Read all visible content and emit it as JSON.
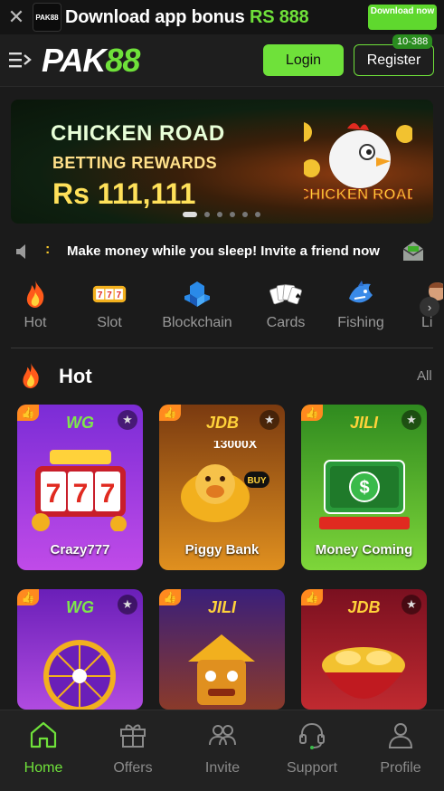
{
  "download_bar": {
    "logo_text": "PAK88",
    "text_prefix": "Download app bonus ",
    "text_amount": "RS 888",
    "button_label": "Download now"
  },
  "header": {
    "logo_pak": "PAK",
    "logo_num": "88",
    "login_label": "Login",
    "register_label": "Register",
    "register_badge": "10-388"
  },
  "banner": {
    "title": "CHICKEN ROAD",
    "subtitle": "BETTING REWARDS",
    "amount": "Rs 111,111",
    "game_logo": "CHICKEN ROAD",
    "slide_count": 6,
    "active_slide": 0
  },
  "marquee": {
    "colon": ":",
    "text": "Make money while you sleep! Invite a friend now"
  },
  "categories": [
    {
      "label": "Hot",
      "icon": "flame-icon"
    },
    {
      "label": "Slot",
      "icon": "slot-777-icon"
    },
    {
      "label": "Blockchain",
      "icon": "blockchain-icon"
    },
    {
      "label": "Cards",
      "icon": "cards-icon"
    },
    {
      "label": "Fishing",
      "icon": "shark-icon"
    },
    {
      "label": "Li",
      "icon": "live-icon"
    }
  ],
  "hot_section": {
    "title": "Hot",
    "all_label": "All"
  },
  "games": [
    {
      "name": "Crazy777",
      "brand": "WG",
      "colors": [
        "#7b2cd6",
        "#c04be8"
      ]
    },
    {
      "name": "Piggy Bank",
      "brand": "JDB",
      "colors": [
        "#7a3a10",
        "#e0901f"
      ],
      "tag": "13000X"
    },
    {
      "name": "Money Coming",
      "brand": "JILI",
      "colors": [
        "#2f8a1f",
        "#7ed63a"
      ]
    },
    {
      "name": "",
      "brand": "WG",
      "colors": [
        "#6a1fb8",
        "#b04be0"
      ]
    },
    {
      "name": "",
      "brand": "JILI",
      "colors": [
        "#3a1f7a",
        "#8a3a2a"
      ]
    },
    {
      "name": "",
      "brand": "JDB",
      "colors": [
        "#7a1020",
        "#c02a30"
      ]
    }
  ],
  "bottom_nav": [
    {
      "label": "Home",
      "icon": "home-icon",
      "active": true
    },
    {
      "label": "Offers",
      "icon": "gift-icon",
      "active": false
    },
    {
      "label": "Invite",
      "icon": "invite-icon",
      "active": false
    },
    {
      "label": "Support",
      "icon": "headset-icon",
      "active": false
    },
    {
      "label": "Profile",
      "icon": "profile-icon",
      "active": false
    }
  ],
  "colors": {
    "accent": "#6fe13a",
    "background": "#1b1b1b",
    "hot_badge": "#ff8a1f"
  }
}
